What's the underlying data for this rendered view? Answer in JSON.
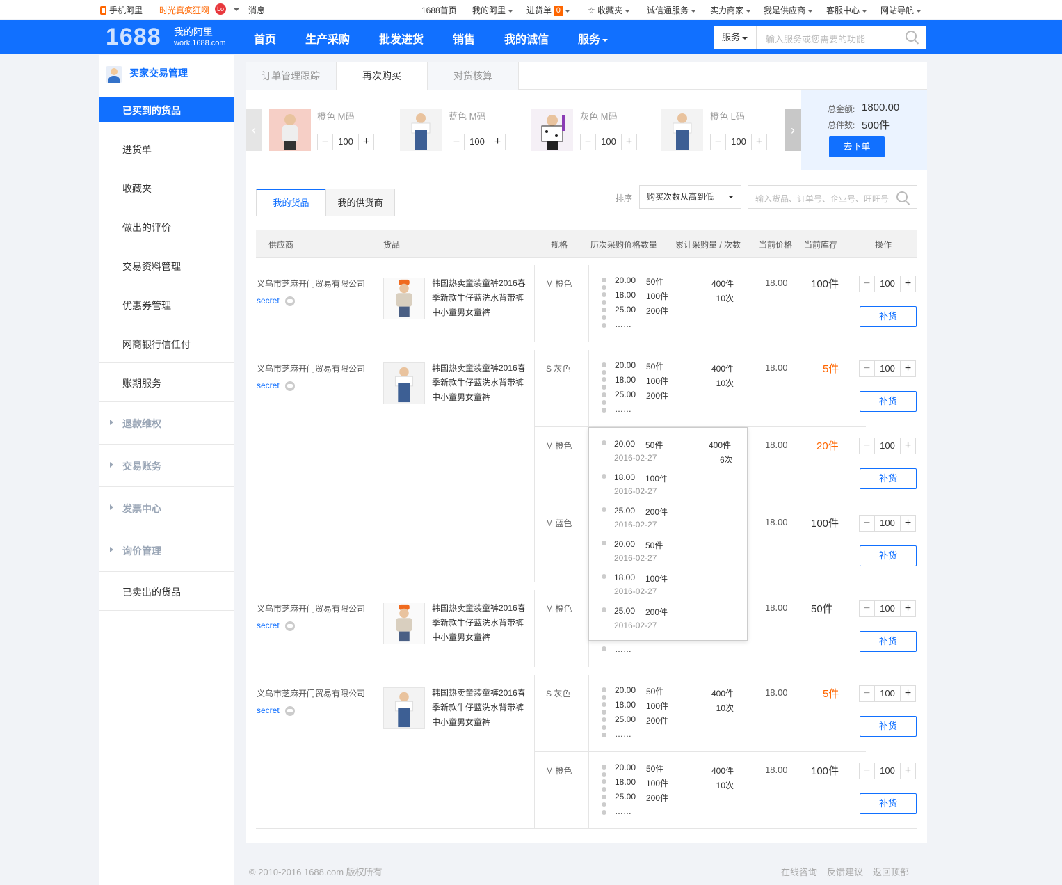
{
  "topbar": {
    "mobile": "手机阿里",
    "promo": "时光真疯狂啊",
    "lo_badge": "Lo",
    "messages": "消息",
    "home_1688": "1688首页",
    "my_ali": "我的阿里",
    "purchase_list": "进货单",
    "purchase_count": "0",
    "favorites": "收藏夹",
    "chengxin": "诚信通服务",
    "merchants": "实力商家",
    "supplier": "我是供应商",
    "service_center": "客服中心",
    "site_nav": "网站导航"
  },
  "header": {
    "logo": "1688",
    "logo_title": "我的阿里",
    "logo_url": "work.1688.com",
    "nav": [
      "首页",
      "生产采购",
      "批发进货",
      "销售",
      "我的诚信",
      "服务"
    ],
    "search_category": "服务",
    "search_placeholder": "输入服务或您需要的功能"
  },
  "sidebar": {
    "title": "买家交易管理",
    "items": [
      "已买到的货品",
      "进货单",
      "收藏夹",
      "做出的评价",
      "交易资料管理",
      "优惠券管理",
      "网商银行信任付",
      "账期服务"
    ],
    "groups": [
      "退款维权",
      "交易账务",
      "发票中心",
      "询价管理"
    ],
    "last": "已卖出的货品"
  },
  "tabs": [
    "订单管理跟踪",
    "再次购买",
    "对货核算"
  ],
  "cart": {
    "items": [
      {
        "label": "橙色  M码",
        "qty": "100"
      },
      {
        "label": "蓝色  M码",
        "qty": "100"
      },
      {
        "label": "灰色  M码",
        "qty": "100"
      },
      {
        "label": "橙色  L码",
        "qty": "100"
      }
    ],
    "total_amount_label": "总金额:",
    "total_amount": "1800.00",
    "total_count_label": "总件数:",
    "total_count": "500件",
    "order_button": "去下单"
  },
  "panel": {
    "tab_my_goods": "我的货品",
    "tab_my_suppliers": "我的供货商",
    "sort_label": "排序",
    "sort_value": "购买次数从高到低",
    "search_placeholder": "输入货品、订单号、企业号、旺旺号"
  },
  "table": {
    "headers": [
      "供应商",
      "货品",
      "规格",
      "历次采购价格数量",
      "累计采购量 / 次数",
      "当前价格",
      "当前库存",
      "操作"
    ],
    "supplier": "义乌市芝麻开门贸易有限公司",
    "seller": "secret",
    "goods_name": "韩国热卖童装童裤2016春季新款牛仔蓝洗水背带裤中小童男女童裤",
    "history": [
      {
        "price": "20.00",
        "qty": "50件"
      },
      {
        "price": "18.00",
        "qty": "100件"
      },
      {
        "price": "25.00",
        "qty": "200件"
      }
    ],
    "ellipsis": "……",
    "cum_qty": "400件",
    "cum_times": "10次",
    "price": "18.00",
    "qty": "100",
    "restock": "补货",
    "rows": [
      {
        "spec": "M  橙色",
        "stock": "100件"
      },
      {
        "spec": "S  灰色",
        "stock": "5件"
      },
      {
        "spec": "M  橙色",
        "stock": "20件"
      },
      {
        "spec": "M  蓝色",
        "stock": "100件"
      },
      {
        "spec": "M  橙色",
        "stock": "50件"
      },
      {
        "spec": "S  灰色",
        "stock": "5件"
      },
      {
        "spec": "M  橙色",
        "stock": "100件"
      }
    ]
  },
  "popup": {
    "cum_qty": "400件",
    "cum_times": "6次",
    "entries": [
      {
        "price": "20.00",
        "qty": "50件",
        "date": "2016-02-27"
      },
      {
        "price": "18.00",
        "qty": "100件",
        "date": "2016-02-27"
      },
      {
        "price": "25.00",
        "qty": "200件",
        "date": "2016-02-27"
      },
      {
        "price": "20.00",
        "qty": "50件",
        "date": "2016-02-27"
      },
      {
        "price": "18.00",
        "qty": "100件",
        "date": "2016-02-27"
      },
      {
        "price": "25.00",
        "qty": "200件",
        "date": "2016-02-27"
      }
    ]
  },
  "footer": {
    "copyright": "© 2010-2016 1688.com 版权所有",
    "links": [
      "在线咨询",
      "反馈建议",
      "返回顶部"
    ]
  }
}
